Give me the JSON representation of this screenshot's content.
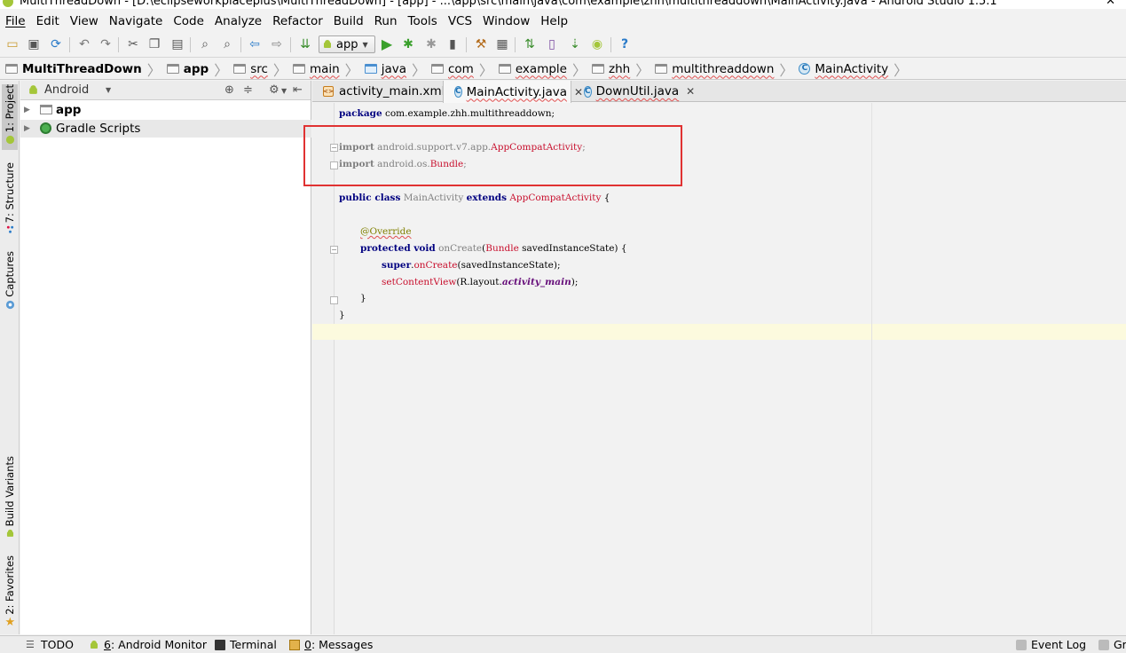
{
  "window": {
    "title": "MultiThreadDown - [D:\\eclipseworkplaceplus\\MultiThreadDown] - [app] - ...\\app\\src\\main\\java\\com\\example\\zhh\\multithreaddown\\MainActivity.java - Android Studio 1.5.1"
  },
  "menu": [
    "File",
    "Edit",
    "View",
    "Navigate",
    "Code",
    "Analyze",
    "Refactor",
    "Build",
    "Run",
    "Tools",
    "VCS",
    "Window",
    "Help"
  ],
  "toolbar": {
    "run_config": "app",
    "icons": [
      "open-folder",
      "save-all",
      "sync",
      "undo",
      "redo",
      "cut",
      "copy",
      "paste",
      "find",
      "replace",
      "back",
      "forward",
      "make-project",
      "run",
      "debug",
      "attach-debugger",
      "stop",
      "project-structure",
      "sdk-manager",
      "gradle-sync",
      "avd-manager",
      "device-monitor",
      "android-monitor",
      "help"
    ]
  },
  "breadcrumb": [
    "MultiThreadDown",
    "app",
    "src",
    "main",
    "java",
    "com",
    "example",
    "zhh",
    "multithreaddown",
    "MainActivity"
  ],
  "left_tools": {
    "project": "1: Project",
    "structure": "7: Structure",
    "captures": "Captures",
    "build_variants": "Build Variants",
    "favorites": "2: Favorites"
  },
  "project_panel": {
    "view_mode": "Android",
    "tree": [
      {
        "label": "app",
        "icon": "module-folder-icon"
      },
      {
        "label": "Gradle Scripts",
        "icon": "gradle-icon"
      }
    ]
  },
  "editor": {
    "tabs": [
      {
        "label": "activity_main.xml",
        "active": false
      },
      {
        "label": "MainActivity.java",
        "active": true
      },
      {
        "label": "DownUtil.java",
        "active": false
      }
    ],
    "code": {
      "l1_kw": "package",
      "l1_rest": " com.example.zhh.multithreaddown;",
      "l3_kw": "import",
      "l3_pkg": " android.support.v7.app.",
      "l3_cls": "AppCompatActivity",
      "l3_end": ";",
      "l4_kw": "import",
      "l4_pkg": " android.os.",
      "l4_cls": "Bundle",
      "l4_end": ";",
      "l6_kw1": "public class",
      "l6_name": " MainActivity ",
      "l6_kw2": "extends",
      "l6_super": " AppCompatActivity",
      "l6_end": " {",
      "l8_ann": "@Override",
      "l9_kw": "protected void",
      "l9_name": " onCreate",
      "l9_p1": "(",
      "l9_type": "Bundle",
      "l9_rest": " savedInstanceState) {",
      "l10_kw": "super",
      "l10_dot": ".",
      "l10_call": "onCreate",
      "l10_rest": "(savedInstanceState);",
      "l11_call": "setContentView",
      "l11_p": "(R.layout.",
      "l11_field": "activity_main",
      "l11_end": ");",
      "l12": "}",
      "l13": "}"
    }
  },
  "bottom_tools": {
    "todo": "TODO",
    "android_monitor_num": "6",
    "android_monitor": ": Android Monitor",
    "terminal": "Terminal",
    "messages_num": "0",
    "messages": ": Messages",
    "event_log": "Event Log",
    "gradle": "Gr"
  },
  "colors": {
    "highlight_box": "#e03232",
    "keyword": "#000080",
    "string_red": "#c8102e",
    "annotation": "#808000"
  }
}
